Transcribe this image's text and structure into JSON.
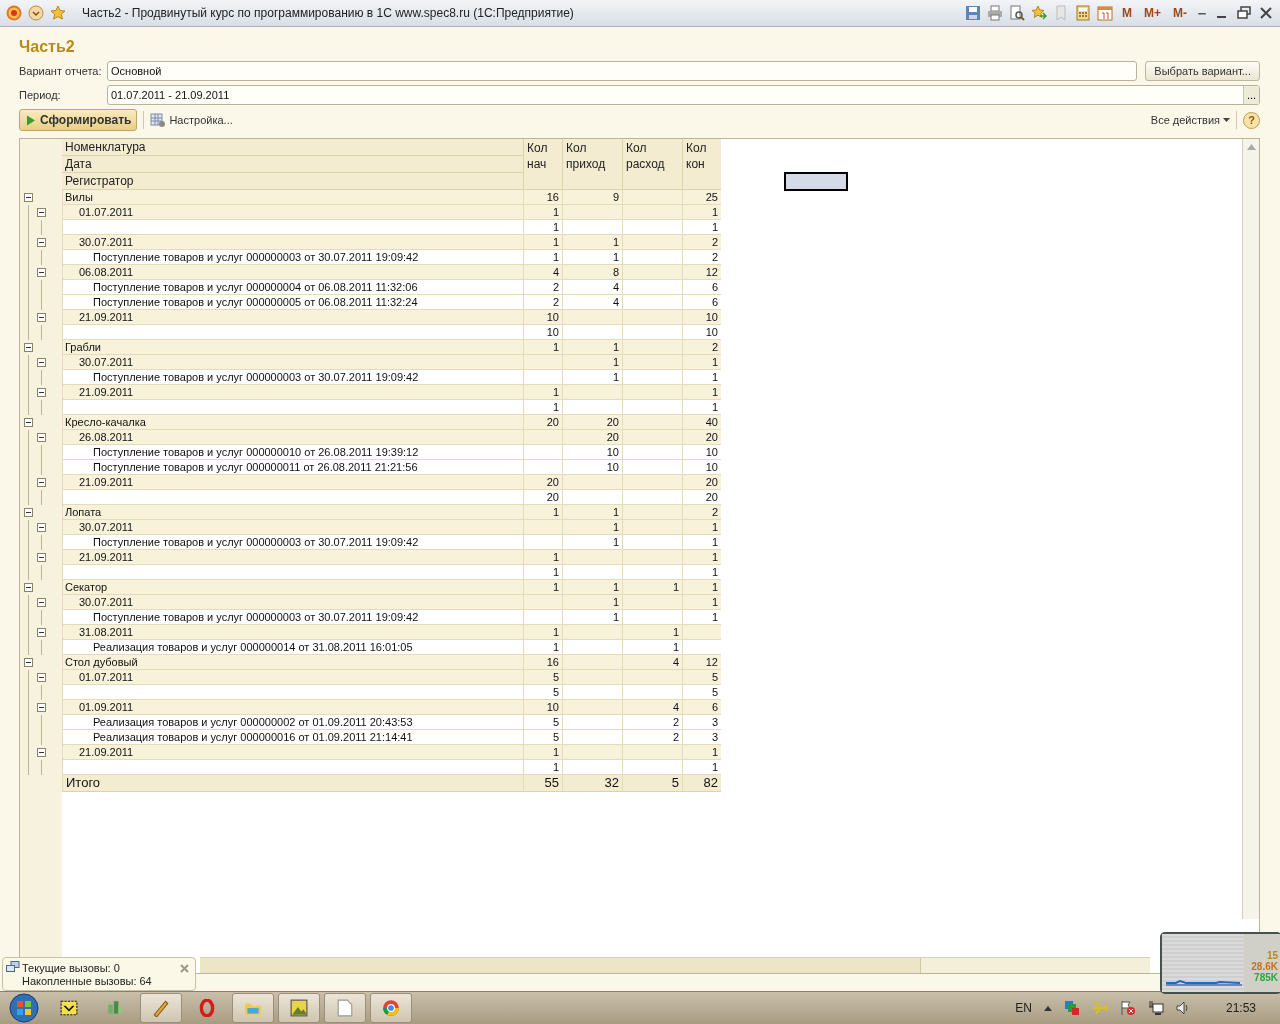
{
  "window": {
    "title": "Часть2 - Продвинутый курс по программированию в 1С www.spec8.ru  (1С:Предприятие)",
    "memory_buttons": [
      "M",
      "M+",
      "M-"
    ]
  },
  "form": {
    "title": "Часть2",
    "fields": [
      {
        "kind": "variant",
        "label": "Вариант отчета:",
        "value": "Основной",
        "button": "Выбрать вариант..."
      },
      {
        "kind": "period",
        "label": "Период:",
        "value": "01.07.2011 - 21.09.2011",
        "button": "..."
      }
    ]
  },
  "toolbar": {
    "generate_button": "Сформировать",
    "settings_button": "Настройка...",
    "all_actions": "Все действия",
    "help": "?"
  },
  "report": {
    "header": {
      "row_fields": [
        "Номенклатура",
        "Дата",
        "Регистратор"
      ],
      "columns": [
        "Кол нач",
        "Кол приход",
        "Кол расход",
        "Кол кон"
      ]
    },
    "rows": [
      {
        "label": "Вилы",
        "expanded": true,
        "nach": "16",
        "prihod": "9",
        "kon": "25",
        "children": [
          {
            "label": "01.07.2011",
            "expanded": true,
            "nach": "1",
            "kon": "1",
            "children": [
              {
                "nach": "1",
                "kon": "1"
              }
            ]
          },
          {
            "label": "30.07.2011",
            "expanded": true,
            "nach": "1",
            "prihod": "1",
            "kon": "2",
            "children": [
              {
                "label": "Поступление товаров и услуг 000000003 от 30.07.2011 19:09:42",
                "nach": "1",
                "prihod": "1",
                "kon": "2"
              }
            ]
          },
          {
            "label": "06.08.2011",
            "expanded": true,
            "nach": "4",
            "prihod": "8",
            "kon": "12",
            "children": [
              {
                "label": "Поступление товаров и услуг 000000004 от 06.08.2011 11:32:06",
                "nach": "2",
                "prihod": "4",
                "kon": "6"
              },
              {
                "label": "Поступление товаров и услуг 000000005 от 06.08.2011 11:32:24",
                "nach": "2",
                "prihod": "4",
                "kon": "6"
              }
            ]
          },
          {
            "label": "21.09.2011",
            "expanded": true,
            "nach": "10",
            "kon": "10",
            "children": [
              {
                "nach": "10",
                "kon": "10"
              }
            ]
          }
        ]
      },
      {
        "label": "Грабли",
        "expanded": true,
        "nach": "1",
        "prihod": "1",
        "kon": "2",
        "children": [
          {
            "label": "30.07.2011",
            "expanded": true,
            "prihod": "1",
            "kon": "1",
            "children": [
              {
                "label": "Поступление товаров и услуг 000000003 от 30.07.2011 19:09:42",
                "prihod": "1",
                "kon": "1"
              }
            ]
          },
          {
            "label": "21.09.2011",
            "expanded": true,
            "nach": "1",
            "kon": "1",
            "children": [
              {
                "nach": "1",
                "kon": "1"
              }
            ]
          }
        ]
      },
      {
        "label": "Кресло-качалка",
        "expanded": true,
        "nach": "20",
        "prihod": "20",
        "kon": "40",
        "children": [
          {
            "label": "26.08.2011",
            "expanded": true,
            "prihod": "20",
            "kon": "20",
            "children": [
              {
                "label": "Поступление товаров и услуг 000000010 от 26.08.2011 19:39:12",
                "prihod": "10",
                "kon": "10"
              },
              {
                "label": "Поступление товаров и услуг 000000011 от 26.08.2011 21:21:56",
                "prihod": "10",
                "kon": "10"
              }
            ]
          },
          {
            "label": "21.09.2011",
            "expanded": true,
            "nach": "20",
            "kon": "20",
            "children": [
              {
                "nach": "20",
                "kon": "20"
              }
            ]
          }
        ]
      },
      {
        "label": "Лопата",
        "expanded": true,
        "nach": "1",
        "prihod": "1",
        "kon": "2",
        "children": [
          {
            "label": "30.07.2011",
            "expanded": true,
            "prihod": "1",
            "kon": "1",
            "children": [
              {
                "label": "Поступление товаров и услуг 000000003 от 30.07.2011 19:09:42",
                "prihod": "1",
                "kon": "1"
              }
            ]
          },
          {
            "label": "21.09.2011",
            "expanded": true,
            "nach": "1",
            "kon": "1",
            "children": [
              {
                "nach": "1",
                "kon": "1"
              }
            ]
          }
        ]
      },
      {
        "label": "Секатор",
        "expanded": true,
        "nach": "1",
        "prihod": "1",
        "rashod": "1",
        "kon": "1",
        "children": [
          {
            "label": "30.07.2011",
            "expanded": true,
            "prihod": "1",
            "kon": "1",
            "children": [
              {
                "label": "Поступление товаров и услуг 000000003 от 30.07.2011 19:09:42",
                "prihod": "1",
                "kon": "1"
              }
            ]
          },
          {
            "label": "31.08.2011",
            "expanded": true,
            "nach": "1",
            "rashod": "1",
            "children": [
              {
                "label": "Реализация товаров и услуг 000000014 от 31.08.2011 16:01:05",
                "nach": "1",
                "rashod": "1"
              }
            ]
          }
        ]
      },
      {
        "label": "Стол дубовый",
        "expanded": true,
        "nach": "16",
        "rashod": "4",
        "kon": "12",
        "children": [
          {
            "label": "01.07.2011",
            "expanded": true,
            "nach": "5",
            "kon": "5",
            "children": [
              {
                "nach": "5",
                "kon": "5"
              }
            ]
          },
          {
            "label": "01.09.2011",
            "expanded": true,
            "nach": "10",
            "rashod": "4",
            "kon": "6",
            "children": [
              {
                "label": "Реализация товаров и услуг 000000002 от 01.09.2011 20:43:53",
                "nach": "5",
                "rashod": "2",
                "kon": "3"
              },
              {
                "label": "Реализация товаров и услуг 000000016 от 01.09.2011 21:14:41",
                "nach": "5",
                "rashod": "2",
                "kon": "3"
              }
            ]
          },
          {
            "label": "21.09.2011",
            "expanded": true,
            "nach": "1",
            "kon": "1",
            "children": [
              {
                "nach": "1",
                "kon": "1"
              }
            ]
          }
        ]
      }
    ],
    "total": {
      "label": "Итого",
      "nach": "55",
      "prihod": "32",
      "rashod": "5",
      "kon": "82"
    }
  },
  "status_popup": {
    "lines": [
      "Текущие вызовы: 0",
      "Накопленные вызовы: 64"
    ]
  },
  "network_gadget": {
    "readings": [
      "15",
      "28.6K",
      "785K"
    ]
  },
  "taskbar": {
    "language": "EN",
    "clock": "21:53"
  }
}
